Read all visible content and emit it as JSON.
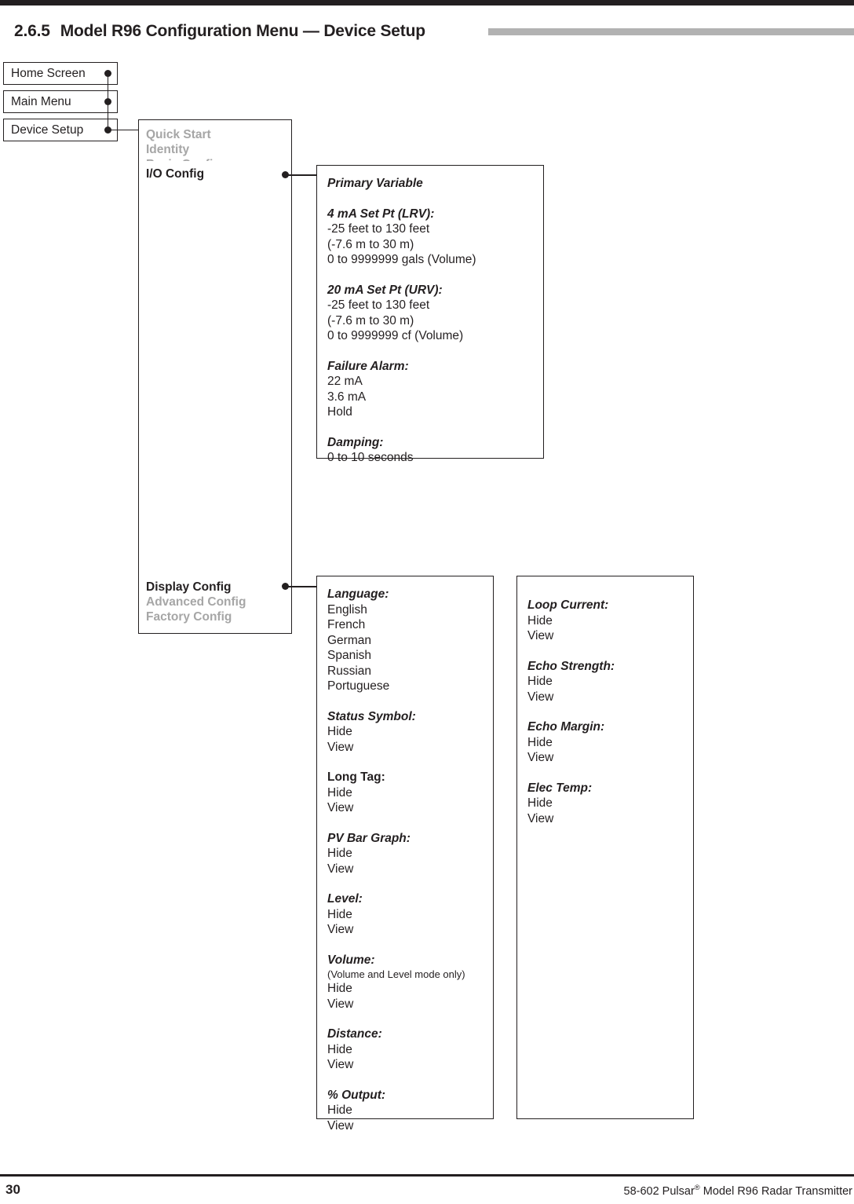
{
  "header": {
    "section_number": "2.6.5",
    "title": "Model R96 Configuration Menu — Device Setup"
  },
  "nav_boxes": [
    {
      "label": "Home Screen"
    },
    {
      "label": "Main Menu"
    },
    {
      "label": "Device Setup"
    }
  ],
  "device_setup_menu": {
    "items": [
      {
        "label": "Quick Start",
        "state": "dim"
      },
      {
        "label": "Identity",
        "state": "dim"
      },
      {
        "label": "Basic Config",
        "state": "dim"
      },
      {
        "label": "I/O Config",
        "state": "active"
      },
      {
        "label": "Display Config",
        "state": "active"
      },
      {
        "label": "Advanced Config",
        "state": "dim"
      },
      {
        "label": "Factory Config",
        "state": "dim"
      }
    ]
  },
  "io_config_box": {
    "title": "Primary Variable",
    "groups": [
      {
        "heading": "4 mA Set Pt (LRV):",
        "values": [
          "-25 feet to 130 feet",
          "(-7.6 m to 30 m)",
          "0 to 9999999 gals (Volume)"
        ]
      },
      {
        "heading": "20 mA Set Pt (URV):",
        "values": [
          "-25 feet to 130 feet",
          "(-7.6 m to 30 m)",
          "0 to 9999999 cf (Volume)"
        ]
      },
      {
        "heading": "Failure Alarm:",
        "values": [
          "22 mA",
          "3.6 mA",
          "Hold"
        ]
      },
      {
        "heading": "Damping:",
        "values": [
          "0 to 10 seconds"
        ]
      }
    ]
  },
  "display_config_box_left": {
    "groups": [
      {
        "heading": "Language:",
        "style": "italic",
        "values": [
          "English",
          "French",
          "German",
          "Spanish",
          "Russian",
          "Portuguese"
        ]
      },
      {
        "heading": "Status Symbol:",
        "style": "italic",
        "values": [
          "Hide",
          "View"
        ]
      },
      {
        "heading": "Long Tag:",
        "style": "upright",
        "values": [
          "Hide",
          "View"
        ]
      },
      {
        "heading": "PV Bar Graph:",
        "style": "italic",
        "values": [
          "Hide",
          "View"
        ]
      },
      {
        "heading": "Level:",
        "style": "italic",
        "values": [
          "Hide",
          "View"
        ]
      },
      {
        "heading": "Volume:",
        "style": "italic",
        "note": "(Volume and Level mode only)",
        "values": [
          "Hide",
          "View"
        ]
      },
      {
        "heading": "Distance:",
        "style": "italic",
        "values": [
          "Hide",
          "View"
        ]
      },
      {
        "heading": "% Output:",
        "style": "italic",
        "values": [
          "Hide",
          "View"
        ]
      }
    ]
  },
  "display_config_box_right": {
    "groups": [
      {
        "heading": "Loop Current:",
        "style": "italic",
        "values": [
          "Hide",
          "View"
        ]
      },
      {
        "heading": "Echo Strength:",
        "style": "italic",
        "values": [
          "Hide",
          "View"
        ]
      },
      {
        "heading": "Echo Margin:",
        "style": "italic",
        "values": [
          "Hide",
          "View"
        ]
      },
      {
        "heading": "Elec Temp:",
        "style": "italic",
        "values": [
          "Hide",
          "View"
        ]
      }
    ]
  },
  "footer": {
    "page_number": "30",
    "text_before": "58-602 Pulsar",
    "registered_mark": "®",
    "text_after": " Model R96 Radar Transmitter"
  },
  "colors": {
    "ink": "#231f20",
    "dim_text": "#a6a6a6",
    "rule_gray": "#b2b2b2"
  }
}
